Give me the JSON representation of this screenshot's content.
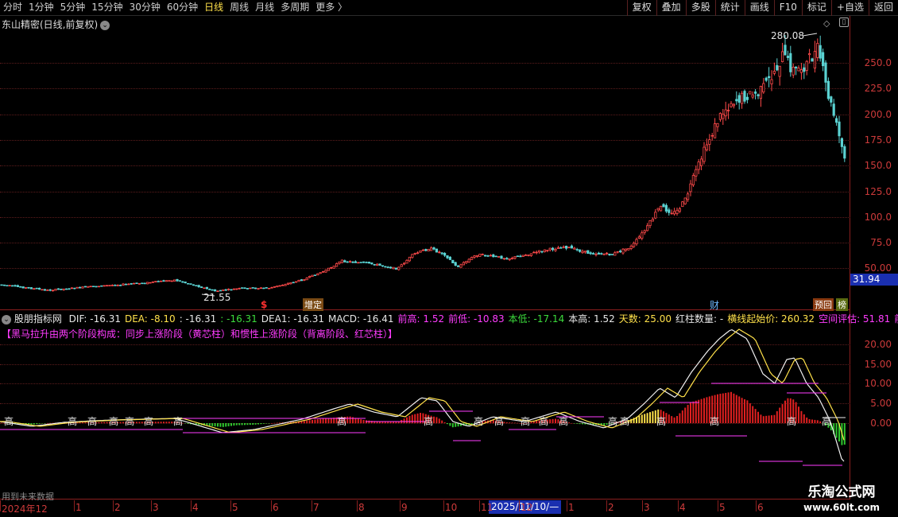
{
  "toolbar": {
    "periods": [
      {
        "label": "分时",
        "active": false
      },
      {
        "label": "1分钟",
        "active": false
      },
      {
        "label": "5分钟",
        "active": false
      },
      {
        "label": "15分钟",
        "active": false
      },
      {
        "label": "30分钟",
        "active": false
      },
      {
        "label": "60分钟",
        "active": false
      },
      {
        "label": "日线",
        "active": true
      },
      {
        "label": "周线",
        "active": false
      },
      {
        "label": "月线",
        "active": false
      },
      {
        "label": "多周期",
        "active": false
      },
      {
        "label": "更多 〉",
        "active": false
      }
    ],
    "tools": [
      "复权",
      "叠加",
      "多股",
      "统计",
      "画线",
      "F10",
      "标记",
      "+自选",
      "返回"
    ]
  },
  "main": {
    "title": "东山精密(日线,前复权)",
    "dropdown_icon": "chevron-down-icon",
    "high_label": "280.08",
    "low_label": "21.55",
    "current_price": "31.94",
    "y_ticks": [
      "250.0",
      "225.0",
      "200.0",
      "175.0",
      "150.0",
      "125.0",
      "100.0",
      "75.0",
      "50.00"
    ],
    "markers": {
      "dollar": "$",
      "zengding": "增定",
      "cai": "财",
      "yuhui": "预回",
      "bang": "榜"
    }
  },
  "indicator": {
    "name": "股朋指标网",
    "fields": [
      {
        "text": "DIF: -16.31",
        "color": "#e6e6e6"
      },
      {
        "text": "DEA: -8.10",
        "color": "#ffe14a"
      },
      {
        "text": ": -16.31",
        "color": "#e6e6e6"
      },
      {
        "text": ": -16.31",
        "color": "#3cdc3c"
      },
      {
        "text": "DEA1: -16.31",
        "color": "#e6e6e6"
      },
      {
        "text": "MACD: -16.41",
        "color": "#e6e6e6"
      },
      {
        "text": "前高: 1.52",
        "color": "#ff3cff"
      },
      {
        "text": "前低: -10.83",
        "color": "#ff3cff"
      },
      {
        "text": "本低: -17.14",
        "color": "#3cdc3c"
      },
      {
        "text": "本高: 1.52",
        "color": "#e6e6e6"
      },
      {
        "text": "天数: 25.00",
        "color": "#ffe14a"
      },
      {
        "text": "红柱数量: -",
        "color": "#e6e6e6"
      },
      {
        "text": "横线起始价: 260.32",
        "color": "#ffe14a"
      },
      {
        "text": "空间评估: 51.81",
        "color": "#ff3cff"
      },
      {
        "text": "前高",
        "color": "#ff3cff"
      }
    ],
    "formula": "【黑马拉升由两个阶段构成：同步上涨阶段（黄芯柱）和惯性上涨阶段（背离阶段、红芯柱）】",
    "y_ticks": [
      "20.00",
      "15.00",
      "10.00",
      "5.00",
      "0.00"
    ],
    "gao_label": "高",
    "footer": "用到未来数据"
  },
  "time_axis": {
    "labels": [
      "2024年12",
      "1",
      "2",
      "3",
      "4",
      "5",
      "6",
      "7",
      "8",
      "9",
      "10",
      "11",
      "12",
      "1",
      "2",
      "3",
      "4",
      "5",
      "6"
    ],
    "cursor_date": "2025/11/10/—"
  },
  "watermark": {
    "line1": "乐淘公式网",
    "line2": "www.60lt.com"
  }
}
